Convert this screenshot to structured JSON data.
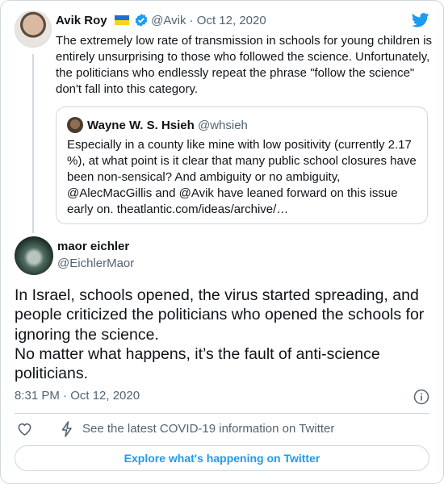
{
  "parent_tweet": {
    "author_name": "Avik Roy",
    "handle": "@Avik",
    "separator": "·",
    "date": "Oct 12, 2020",
    "text": "The extremely low rate of transmission in schools for young children is entirely unsurprising to those who followed the science. Unfortunately, the politicians who endlessly repeat the phrase \"follow the science\" don't fall into this category."
  },
  "quoted_tweet": {
    "author_name": "Wayne W. S. Hsieh",
    "handle": "@whsieh",
    "text": "Especially in a county like mine with low positivity (currently 2.17 %), at what point is it clear that many public school closures have been non-sensical?  And ambiguity or no ambiguity, @AlecMacGillis and @Avik have leaned forward on this issue early on. theatlantic.com/ideas/archive/…"
  },
  "main_tweet": {
    "author_name": "maor eichler",
    "handle": "@EichlerMaor",
    "text": "In Israel, schools opened, the virus started spreading, and people criticized the politicians who opened the schools for ignoring the science.\nNo matter what happens, it’s the fault of anti-science politicians.",
    "timestamp": "8:31 PM · Oct 12, 2020"
  },
  "actions": {
    "covid_link": "See the latest COVID-19 information on Twitter"
  },
  "explore_button": "Explore what's happening on Twitter",
  "icons": [
    "twitter-logo-icon",
    "ukraine-flag-icon",
    "verified-badge-icon",
    "info-icon",
    "heart-icon",
    "lightning-bolt-icon"
  ],
  "colors": {
    "accent": "#1d9bf0",
    "secondary_text": "#536471",
    "border": "#cfd9de"
  }
}
